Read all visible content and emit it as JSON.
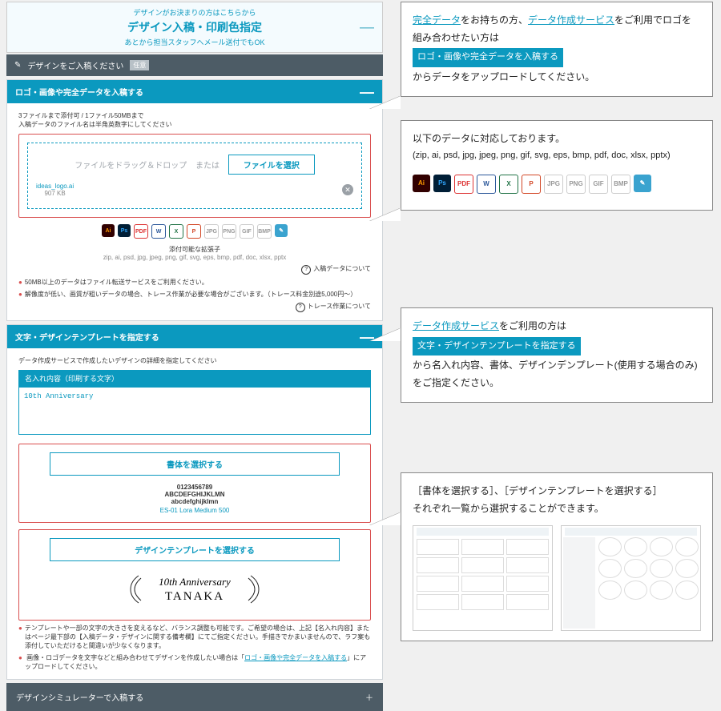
{
  "ribbon": {
    "line1": "デザインがお決まりの方はこちらから",
    "line2": "デザイン入稿・印刷色指定",
    "line3": "あとから担当スタッフへメール送付でもOK"
  },
  "title": {
    "text": "デザインをご入稿ください",
    "badge": "任意"
  },
  "sec1": {
    "head": "ロゴ・画像や完全データを入稿する",
    "limit1": "3ファイルまで添付可 / 1ファイル50MBまで",
    "limit2": "入稿データのファイル名は半角英数字にしてください",
    "drop": "ファイルをドラッグ＆ドロップ",
    "or": "または",
    "choose": "ファイルを選択",
    "file": "ideas_logo.ai",
    "filesize": "907 KB",
    "extlabel": "添付可能な拡張子",
    "exts": "zip, ai, psd, jpg, jpeg, png, gif, svg, eps, bmp, pdf, doc, xlsx, pptx",
    "help1": "入稿データについて",
    "note1": "50MB以上のデータはファイル転送サービスをご利用ください。",
    "note2": "解像度が低い、画質が粗いデータの場合、トレース作業が必要な場合がございます。（トレース料金別途5,000円～）",
    "help2": "トレース作業について"
  },
  "sec2": {
    "head": "文字・デザインテンプレートを指定する",
    "intro": "データ作成サービスで作成したいデザインの詳細を指定してください",
    "field": "名入れ内容（印刷する文字）",
    "value": "10th Anniversary",
    "btn_font": "書体を選択する",
    "samp_num": "0123456789",
    "samp_up": "ABCDEFGHIJKLMN",
    "samp_low": "abcdefghijklmn",
    "samp_lbl": "ES-01 Lora Medium 500",
    "btn_tpl": "デザインテンプレートを選択する",
    "logo_l1": "10th Anniversary",
    "logo_l2": "TANAKA",
    "note1": "テンプレートや一部の文字の大きさを変えるなど、バランス調整も可能です。ご希望の場合は、上記【名入れ内容】またはページ最下部の【入稿データ・デザインに関する備考欄】にてご指定ください。手描きでかまいませんので、ラフ案も添付していただけると間違いが少なくなります。",
    "note2_a": "画像・ロゴデータを文字などと組み合わせてデザインを作成したい場合は「",
    "note2_link": "ロゴ・画像や完全データを入稿する",
    "note2_b": "」にアップロードしてください。"
  },
  "collapse": "デザインシミュレーターで入稿する",
  "call1": {
    "t1a": "完全データ",
    "t1b": "をお持ちの方、",
    "t1c": "データ作成サービス",
    "t1d": "をご利用でロゴを組み合わせたい方は",
    "tag": "ロゴ・画像や完全データを入稿する",
    "t2": "からデータをアップロードしてください。"
  },
  "call2": {
    "line": "以下のデータに対応しております。",
    "fmt": "(zip, ai, psd, jpg, jpeg, png, gif, svg, eps, bmp, pdf, doc, xlsx, pptx)"
  },
  "call3": {
    "t1": "データ作成サービス",
    "t2": "をご利用の方は",
    "tag": "文字・デザインテンプレートを指定する",
    "t3": "から名入れ内容、書体、デザインデンプレート(使用する場合のみ)をご指定ください。"
  },
  "call4": {
    "line1": "［書体を選択する］、［デザインテンプレートを選択する］",
    "line2": "それぞれ一覧から選択することができます。"
  }
}
